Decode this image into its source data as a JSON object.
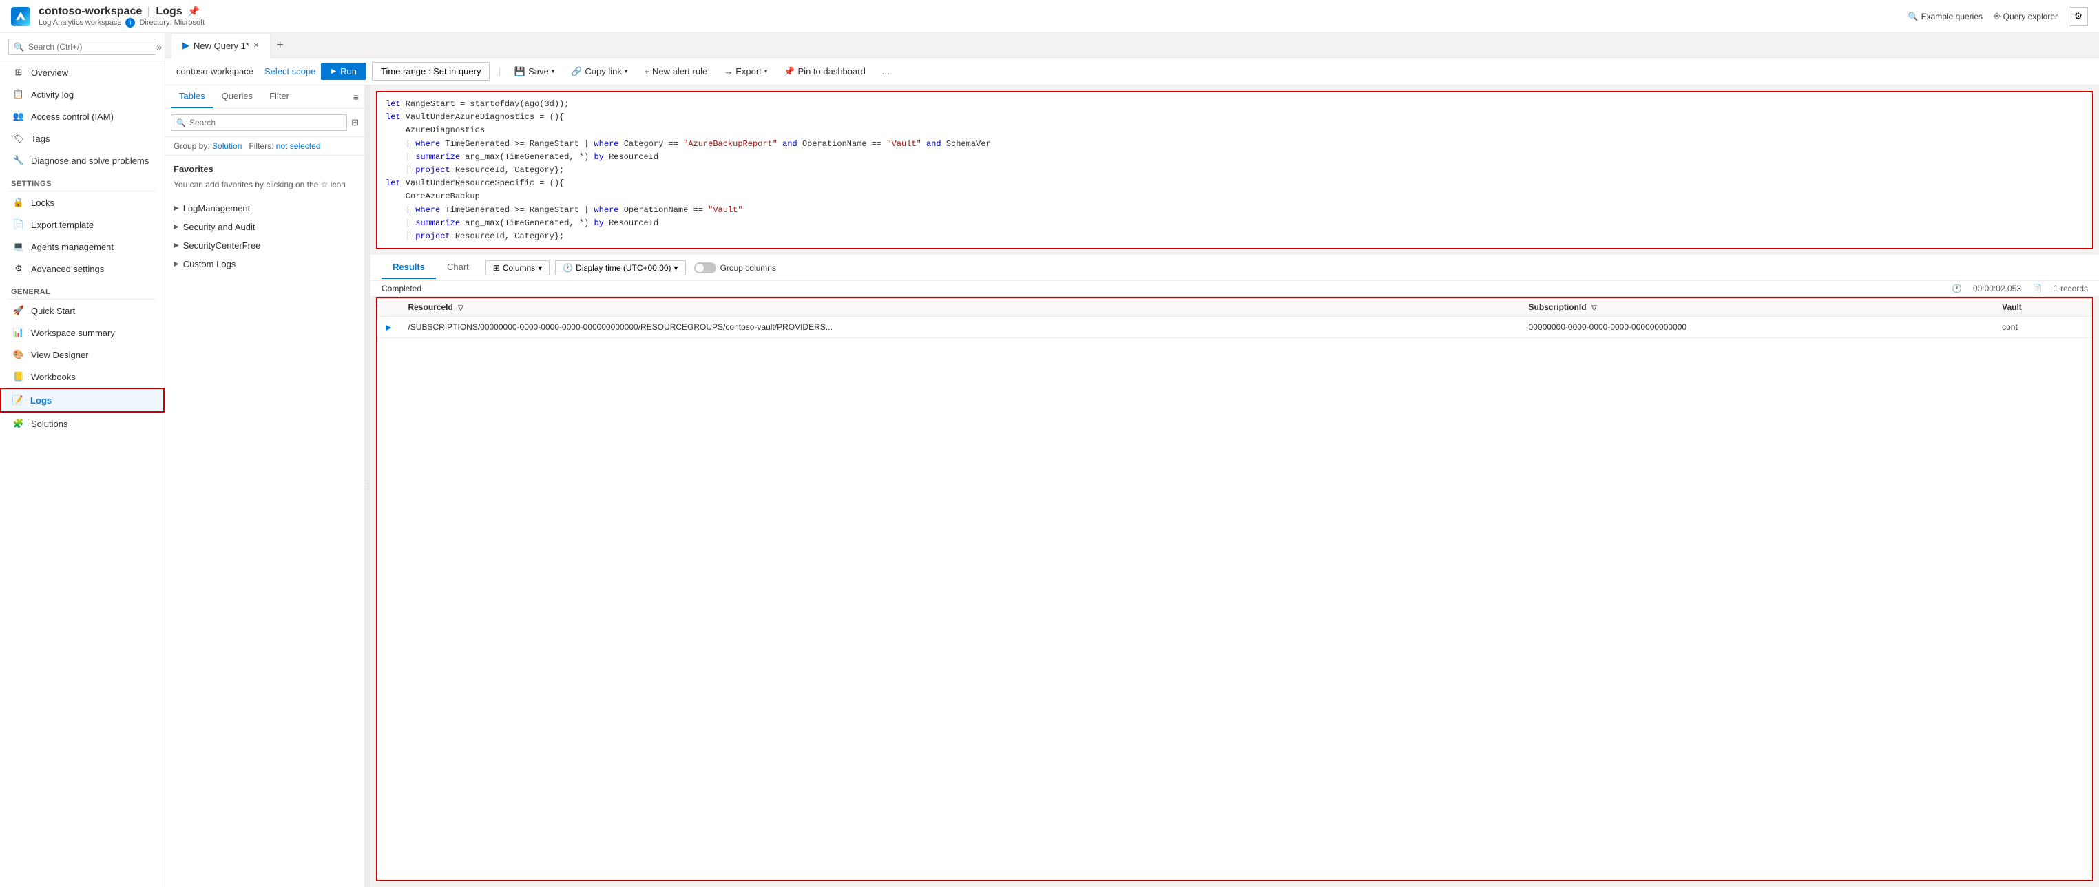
{
  "header": {
    "app_logo_alt": "Azure",
    "workspace_name": "contoso-workspace",
    "separator": "|",
    "page_title": "Logs",
    "pin_icon": "📌",
    "sub_label": "Log Analytics workspace",
    "directory_label": "Directory: Microsoft"
  },
  "top_right": {
    "example_queries_label": "Example queries",
    "query_explorer_label": "Query explorer",
    "settings_icon": "⚙"
  },
  "sidebar": {
    "search_placeholder": "Search (Ctrl+/)",
    "items": [
      {
        "id": "overview",
        "label": "Overview",
        "icon": "⊞"
      },
      {
        "id": "activity-log",
        "label": "Activity log",
        "icon": "📋"
      },
      {
        "id": "access-control",
        "label": "Access control (IAM)",
        "icon": "👥"
      },
      {
        "id": "tags",
        "label": "Tags",
        "icon": "🏷"
      },
      {
        "id": "diagnose",
        "label": "Diagnose and solve problems",
        "icon": "🔧"
      }
    ],
    "settings_section": "Settings",
    "settings_items": [
      {
        "id": "locks",
        "label": "Locks",
        "icon": "🔒"
      },
      {
        "id": "export-template",
        "label": "Export template",
        "icon": "📄"
      },
      {
        "id": "agents-management",
        "label": "Agents management",
        "icon": "💻"
      },
      {
        "id": "advanced-settings",
        "label": "Advanced settings",
        "icon": "⚙"
      }
    ],
    "general_section": "General",
    "general_items": [
      {
        "id": "quick-start",
        "label": "Quick Start",
        "icon": "🚀"
      },
      {
        "id": "workspace-summary",
        "label": "Workspace summary",
        "icon": "📊"
      },
      {
        "id": "view-designer",
        "label": "View Designer",
        "icon": "🎨"
      },
      {
        "id": "workbooks",
        "label": "Workbooks",
        "icon": "📒"
      },
      {
        "id": "logs",
        "label": "Logs",
        "icon": "📝",
        "active": true
      },
      {
        "id": "solutions",
        "label": "Solutions",
        "icon": "🧩"
      }
    ]
  },
  "tab_bar": {
    "tab_icon": "▶",
    "tab_label": "New Query 1*",
    "add_icon": "+"
  },
  "query_toolbar": {
    "workspace": "contoso-workspace",
    "select_scope": "Select scope",
    "run_label": "Run",
    "time_range_label": "Time range : Set in query",
    "save_label": "Save",
    "copy_link_label": "Copy link",
    "new_alert_rule_label": "New alert rule",
    "export_label": "Export",
    "pin_to_dashboard_label": "Pin to dashboard",
    "more_icon": "..."
  },
  "left_panel": {
    "tabs": [
      "Tables",
      "Queries",
      "Filter"
    ],
    "active_tab": "Tables",
    "search_placeholder": "Search",
    "group_by_label": "Group by:",
    "group_by_value": "Solution",
    "filters_label": "Filters:",
    "filters_value": "not selected",
    "favorites_title": "Favorites",
    "favorites_hint": "You can add favorites by clicking on the ☆ icon",
    "tree_items": [
      "LogManagement",
      "Security and Audit",
      "SecurityCenterFree",
      "Custom Logs"
    ]
  },
  "query_editor": {
    "lines": [
      "let RangeStart = startofday(ago(3d));",
      "let VaultUnderAzureDiagnostics = (){",
      "    AzureDiagnostics",
      "    | where TimeGenerated >= RangeStart | where Category == \"AzureBackupReport\" and OperationName == \"Vault\" and SchemaVer",
      "    | summarize arg_max(TimeGenerated, *) by ResourceId",
      "    | project ResourceId, Category};",
      "let VaultUnderResourceSpecific = (){",
      "    CoreAzureBackup",
      "    | where TimeGenerated >= RangeStart | where OperationName == \"Vault\"",
      "    | summarize arg_max(TimeGenerated, *) by ResourceId",
      "    | project ResourceId, Category};"
    ]
  },
  "results": {
    "tabs": [
      "Results",
      "Chart"
    ],
    "active_tab": "Results",
    "columns_label": "Columns",
    "display_time_label": "Display time (UTC+00:00)",
    "group_columns_label": "Group columns",
    "status": "Completed",
    "duration": "00:00:02.053",
    "records": "1 records",
    "table": {
      "columns": [
        "ResourceId",
        "SubscriptionId",
        "Vault"
      ],
      "rows": [
        {
          "expand": ">",
          "resource_id": "/SUBSCRIPTIONS/00000000-0000-0000-0000-000000000000/RESOURCEGROUPS/contoso-vault/PROVIDERS...",
          "subscription_id": "00000000-0000-0000-0000-000000000000",
          "vault": "cont"
        }
      ]
    }
  }
}
